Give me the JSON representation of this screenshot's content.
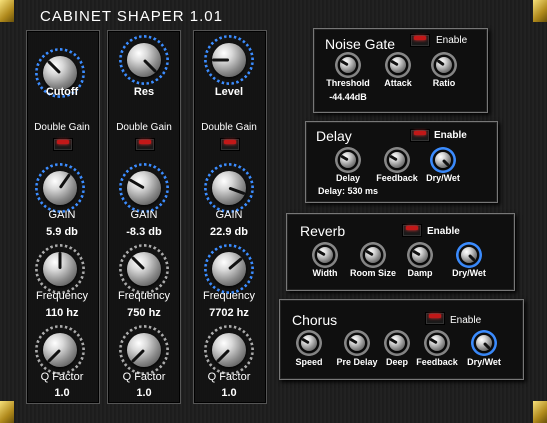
{
  "title": "CABINET SHAPER 1.01",
  "colors": {
    "accent": "#3b8cff",
    "led": "#c21818",
    "gold": "#d4b13a"
  },
  "eq_bands": [
    {
      "top_knob": "Cutoff",
      "double_gain": "Double Gain",
      "gain_label": "GAIN",
      "gain_value": "5.9 db",
      "frequency_label": "Frequency",
      "frequency_value": "110 hz",
      "q_label": "Q Factor",
      "q_value": "1.0"
    },
    {
      "top_knob": "Res",
      "double_gain": "Double Gain",
      "gain_label": "GAIN",
      "gain_value": "-8.3 db",
      "frequency_label": "Frequency",
      "frequency_value": "750 hz",
      "q_label": "Q Factor",
      "q_value": "1.0"
    },
    {
      "top_knob": "Level",
      "double_gain": "Double Gain",
      "gain_label": "GAIN",
      "gain_value": "22.9 db",
      "frequency_label": "Frequency",
      "frequency_value": "7702 hz",
      "q_label": "Q Factor",
      "q_value": "1.0"
    }
  ],
  "noise_gate": {
    "title": "Noise Gate",
    "enable": "Enable",
    "threshold": "Threshold",
    "threshold_value": "-44.44dB",
    "attack": "Attack",
    "ratio": "Ratio"
  },
  "delay": {
    "title": "Delay",
    "enable": "Enable",
    "delay": "Delay",
    "feedback": "Feedback",
    "dry_wet": "Dry/Wet",
    "readout": "Delay: 530 ms"
  },
  "reverb": {
    "title": "Reverb",
    "enable": "Enable",
    "width": "Width",
    "room_size": "Room Size",
    "damp": "Damp",
    "dry_wet": "Dry/Wet"
  },
  "chorus": {
    "title": "Chorus",
    "enable": "Enable",
    "speed": "Speed",
    "pre_delay": "Pre Delay",
    "deep": "Deep",
    "feedback": "Feedback",
    "dry_wet": "Dry/Wet"
  }
}
